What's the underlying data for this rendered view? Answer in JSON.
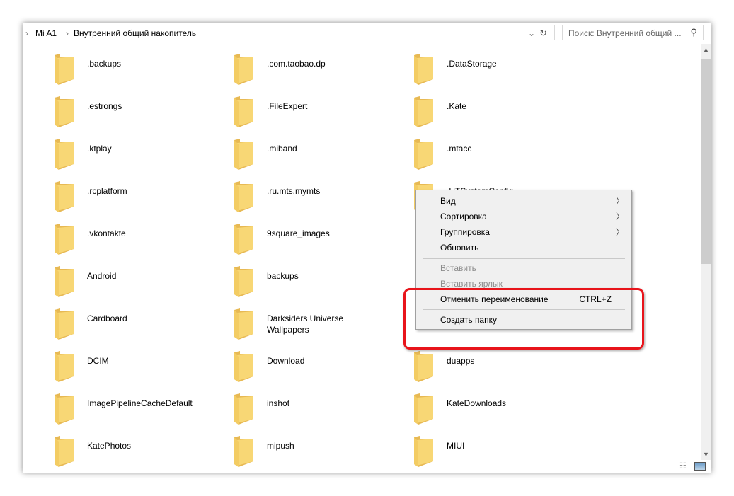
{
  "address": {
    "crumbs": [
      "Mi A1",
      "Внутренний общий накопитель"
    ]
  },
  "search": {
    "placeholder": "Поиск: Внутренний общий ..."
  },
  "folders": [
    [
      ".backups",
      ".com.taobao.dp",
      ".DataStorage"
    ],
    [
      ".estrongs",
      ".FileExpert",
      ".Kate"
    ],
    [
      ".ktplay",
      ".miband",
      ".mtacc"
    ],
    [
      ".rcplatform",
      ".ru.mts.mymts",
      ".UTSystemConfig"
    ],
    [
      ".vkontakte",
      "9square_images",
      ""
    ],
    [
      "Android",
      "backups",
      ""
    ],
    [
      "Cardboard",
      "Darksiders Universe Wallpapers",
      ""
    ],
    [
      "DCIM",
      "Download",
      "duapps"
    ],
    [
      "ImagePipelineCacheDefault",
      "inshot",
      "KateDownloads"
    ],
    [
      "KatePhotos",
      "mipush",
      "MIUI"
    ]
  ],
  "context_menu": {
    "view": "Вид",
    "sort": "Сортировка",
    "group": "Группировка",
    "refresh": "Обновить",
    "paste": "Вставить",
    "paste_shortcut": "Вставить ярлык",
    "undo_rename": "Отменить переименование",
    "undo_shortcut": "CTRL+Z",
    "new_folder": "Создать папку"
  },
  "colors": {
    "highlight": "#e8141b",
    "folder": "#f8d775"
  }
}
